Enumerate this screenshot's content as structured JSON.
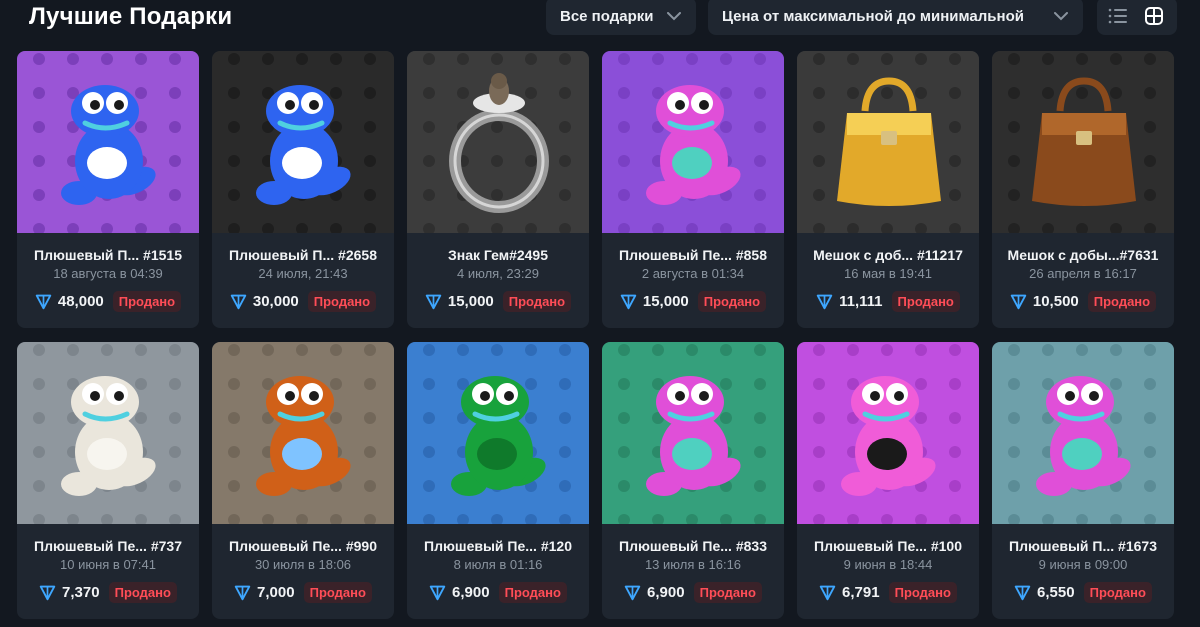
{
  "header": {
    "title": "Лучшие Подарки",
    "filter_label": "Все подарки",
    "sort_label": "Цена от максимальной до минимальной"
  },
  "cards": [
    {
      "name": "Плюшевый П...  #1515",
      "date": "18 августа в 04:39",
      "price": "48,000",
      "status": "Продано",
      "bg": "#9a55d6",
      "pattern": "#7c3fba",
      "kind": "frog",
      "body": "#2e64f0",
      "belly": "#ffffff"
    },
    {
      "name": "Плюшевый П... #2658",
      "date": "24 июля, 21:43",
      "price": "30,000",
      "status": "Продано",
      "bg": "#2a2a2a",
      "pattern": "#1e1e1e",
      "kind": "frog",
      "body": "#2e64f0",
      "belly": "#ffffff"
    },
    {
      "name": "Знак Гем#2495",
      "date": "4 июля, 23:29",
      "price": "15,000",
      "status": "Продано",
      "bg": "#3c3c3c",
      "pattern": "#2f2f2f",
      "kind": "ring"
    },
    {
      "name": "Плюшевый Пе... #858",
      "date": "2 августа в 01:34",
      "price": "15,000",
      "status": "Продано",
      "bg": "#8b4fd8",
      "pattern": "#7a40c4",
      "kind": "frog",
      "body": "#e04fd8",
      "belly": "#4fd0c0"
    },
    {
      "name": "Мешок с доб... #11217",
      "date": "16 мая в 19:41",
      "price": "11,111",
      "status": "Продано",
      "bg": "#3a3a3a",
      "pattern": "#2c2c2c",
      "kind": "bag",
      "body": "#e2a92a",
      "belly": "#f5cf55"
    },
    {
      "name": "Мешок с добы...#7631",
      "date": "26 апреля в 16:17",
      "price": "10,500",
      "status": "Продано",
      "bg": "#2e2e2e",
      "pattern": "#222222",
      "kind": "bag",
      "body": "#8a4a1c",
      "belly": "#b0672b"
    },
    {
      "name": "Плюшевый Пе... #737",
      "date": "10 июня в 07:41",
      "price": "7,370",
      "status": "Продано",
      "bg": "#8f979e",
      "pattern": "#7d858c",
      "kind": "frog",
      "body": "#eae6dc",
      "belly": "#f7f5ef"
    },
    {
      "name": "Плюшевый Пе... #990",
      "date": "30 июля в 18:06",
      "price": "7,000",
      "status": "Продано",
      "bg": "#85796a",
      "pattern": "#726759",
      "kind": "frog",
      "body": "#d06018",
      "belly": "#7fc3ff"
    },
    {
      "name": "Плюшевый Пе... #120",
      "date": "8 июля в 01:16",
      "price": "6,900",
      "status": "Продано",
      "bg": "#3b7fd0",
      "pattern": "#2f6cb8",
      "kind": "frog",
      "body": "#18a23c",
      "belly": "#0f7a2b"
    },
    {
      "name": "Плюшевый Пе... #833",
      "date": "13 июля в 16:16",
      "price": "6,900",
      "status": "Продано",
      "bg": "#35a07c",
      "pattern": "#2b8a69",
      "kind": "frog",
      "body": "#e04fd8",
      "belly": "#4fd0c0"
    },
    {
      "name": "Плюшевый Пе... #100",
      "date": "9 июня в 18:44",
      "price": "6,791",
      "status": "Продано",
      "bg": "#c04fe0",
      "pattern": "#a83ec8",
      "kind": "frog",
      "body": "#f05cd8",
      "belly": "#1a1a1a"
    },
    {
      "name": "Плюшевый П... #1673",
      "date": "9 июня в 09:00",
      "price": "6,550",
      "status": "Продано",
      "bg": "#6ea0aa",
      "pattern": "#5b8c96",
      "kind": "frog",
      "body": "#e04fd8",
      "belly": "#4fd0c0"
    }
  ]
}
